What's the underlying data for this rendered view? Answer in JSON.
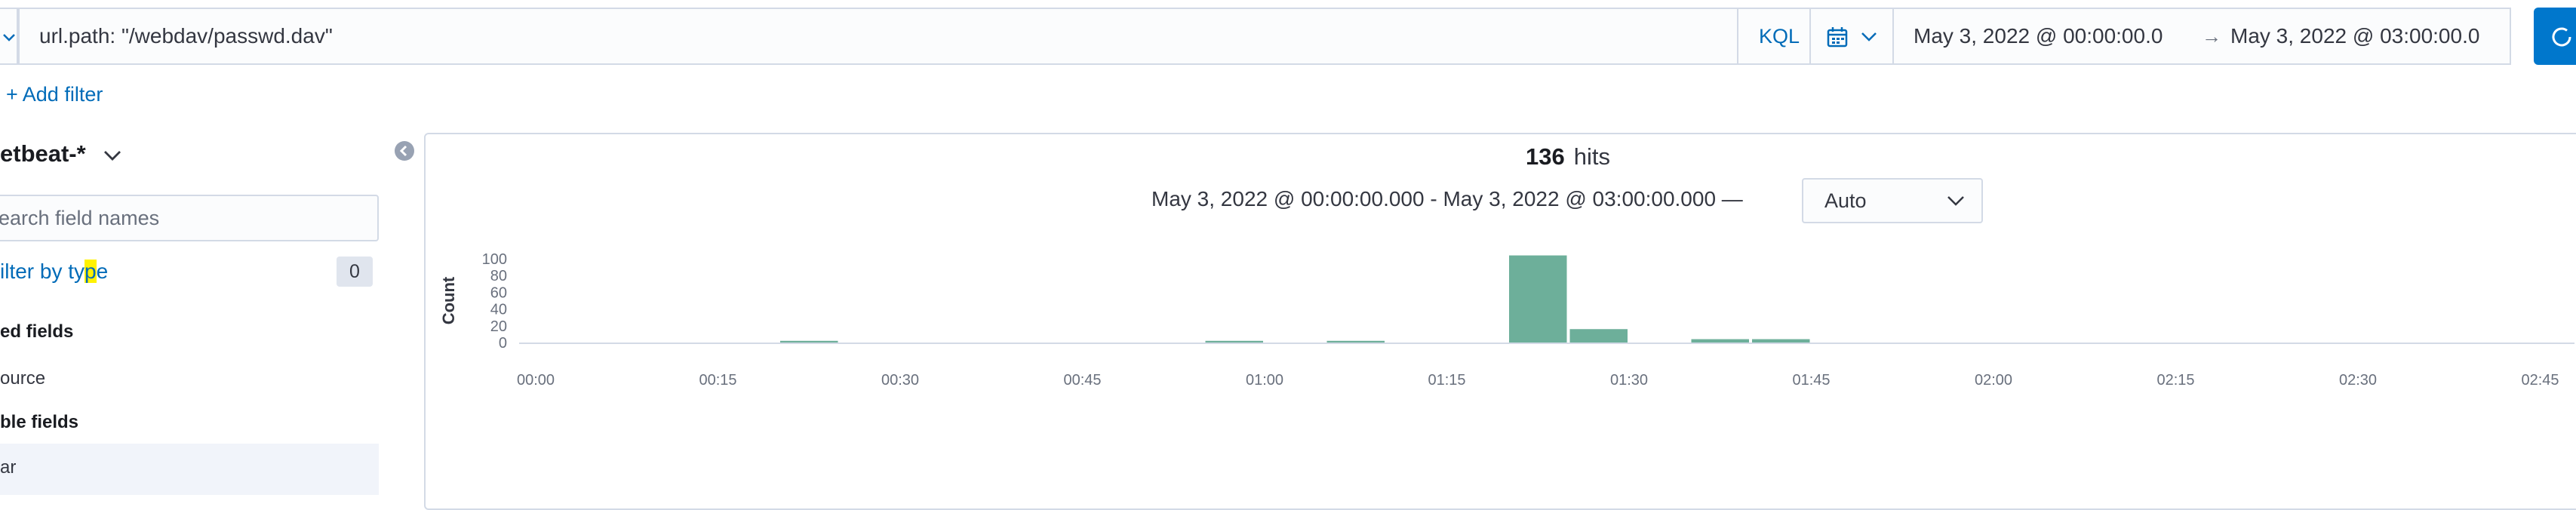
{
  "query": {
    "text": "url.path: \"/webdav/passwd.dav\"",
    "language": "KQL"
  },
  "time_range": {
    "start": "May 3, 2022 @ 00:00:00.0",
    "arrow": "→",
    "end": "May 3, 2022 @ 03:00:00.0"
  },
  "filters": {
    "add_label": "+ Add filter"
  },
  "sidebar": {
    "index_pattern": "etbeat-*",
    "search_placeholder": "earch field names",
    "filter_by_type_pre": "ilter by ty",
    "filter_by_type_hl": "p",
    "filter_by_type_post": "e",
    "filter_count": "0",
    "selected_fields_heading": "ed fields",
    "selected_fields": [
      "ource"
    ],
    "available_fields_heading": "ble fields",
    "available_fields": [
      "ar"
    ]
  },
  "results": {
    "hits_count": "136",
    "hits_label": "hits",
    "range_text": "May 3, 2022 @ 00:00:00.000 - May 3, 2022 @ 03:00:00.000 —",
    "interval": "Auto"
  },
  "colors": {
    "accent": "#006bb8",
    "primary_button": "#0077cc",
    "bar": "#6daf9a",
    "border": "#d3dae6"
  },
  "chart_data": {
    "type": "bar",
    "ylabel": "Count",
    "ylim": [
      0,
      100
    ],
    "yticks": [
      0,
      20,
      40,
      60,
      80,
      100
    ],
    "xticks": [
      "00:00",
      "00:15",
      "00:30",
      "00:45",
      "01:00",
      "01:15",
      "01:30",
      "01:45",
      "02:00",
      "02:15",
      "02:30",
      "02:45"
    ],
    "bucket_minutes": 5,
    "buckets": [
      {
        "start": "00:20",
        "value": 2
      },
      {
        "start": "00:55",
        "value": 2
      },
      {
        "start": "01:05",
        "value": 2
      },
      {
        "start": "01:20",
        "value": 104
      },
      {
        "start": "01:25",
        "value": 16
      },
      {
        "start": "01:35",
        "value": 4
      },
      {
        "start": "01:40",
        "value": 4
      }
    ]
  }
}
